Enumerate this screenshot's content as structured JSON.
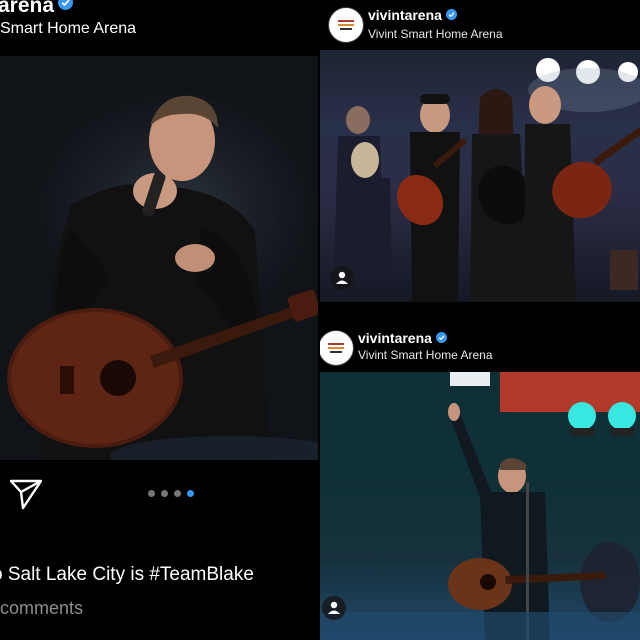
{
  "left_post": {
    "username": "arena",
    "location": "Smart Home Arena",
    "caption": "o Salt Lake City is #TeamBlake",
    "comments_link": "comments",
    "carousel_total": 4,
    "carousel_active": 4
  },
  "right_posts": [
    {
      "username": "vivintarena",
      "location": "Vivint Smart Home Arena"
    },
    {
      "username": "vivintarena",
      "location": "Vivint Smart Home Arena"
    }
  ],
  "icons": {
    "verified": "verified-badge-icon",
    "send": "paper-plane-icon",
    "tag": "user-tag-icon"
  },
  "colors": {
    "background": "#000000",
    "verified_blue": "#3897f0",
    "muted_text": "#8e8e8e",
    "stage_red": "#b23a2a",
    "stage_cyan": "#38e8e0"
  }
}
